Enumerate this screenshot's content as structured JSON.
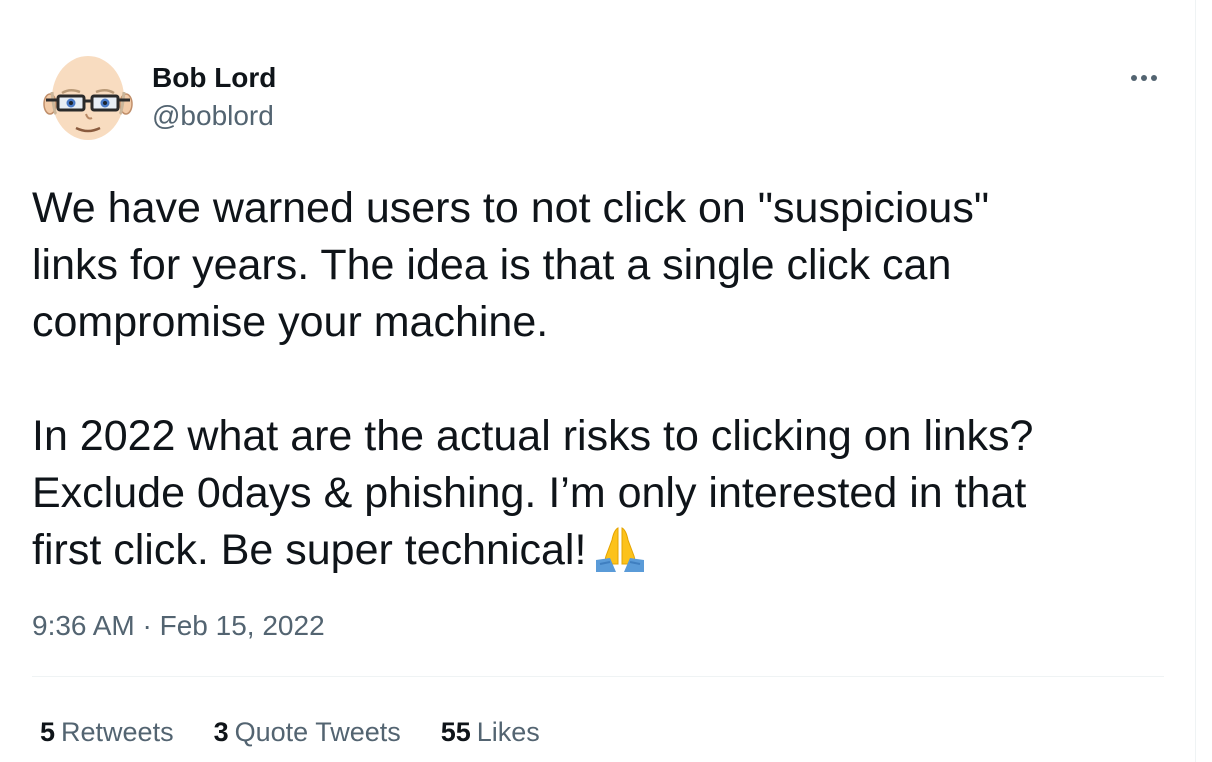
{
  "author": {
    "display_name": "Bob Lord",
    "handle": "@boblord"
  },
  "tweet": {
    "line1": "We have warned users to not click on \"suspicious\"",
    "line2": "links for years. The idea is that a single click can",
    "line3": "compromise your machine.",
    "line4": "In 2022 what are the actual risks to clicking on links?",
    "line5": "Exclude 0days & phishing. I’m only interested in that",
    "line6": "first click. Be super technical!",
    "emoji": "folded-hands-icon"
  },
  "timestamp": {
    "time": "9:36 AM",
    "separator": " · ",
    "date": "Feb 15, 2022"
  },
  "stats": {
    "retweets_count": "5",
    "retweets_label": "Retweets",
    "quotes_count": "3",
    "quotes_label": "Quote Tweets",
    "likes_count": "55",
    "likes_label": "Likes"
  },
  "colors": {
    "text_primary": "#0f1419",
    "text_secondary": "#536471",
    "divider": "#eff3f4"
  }
}
